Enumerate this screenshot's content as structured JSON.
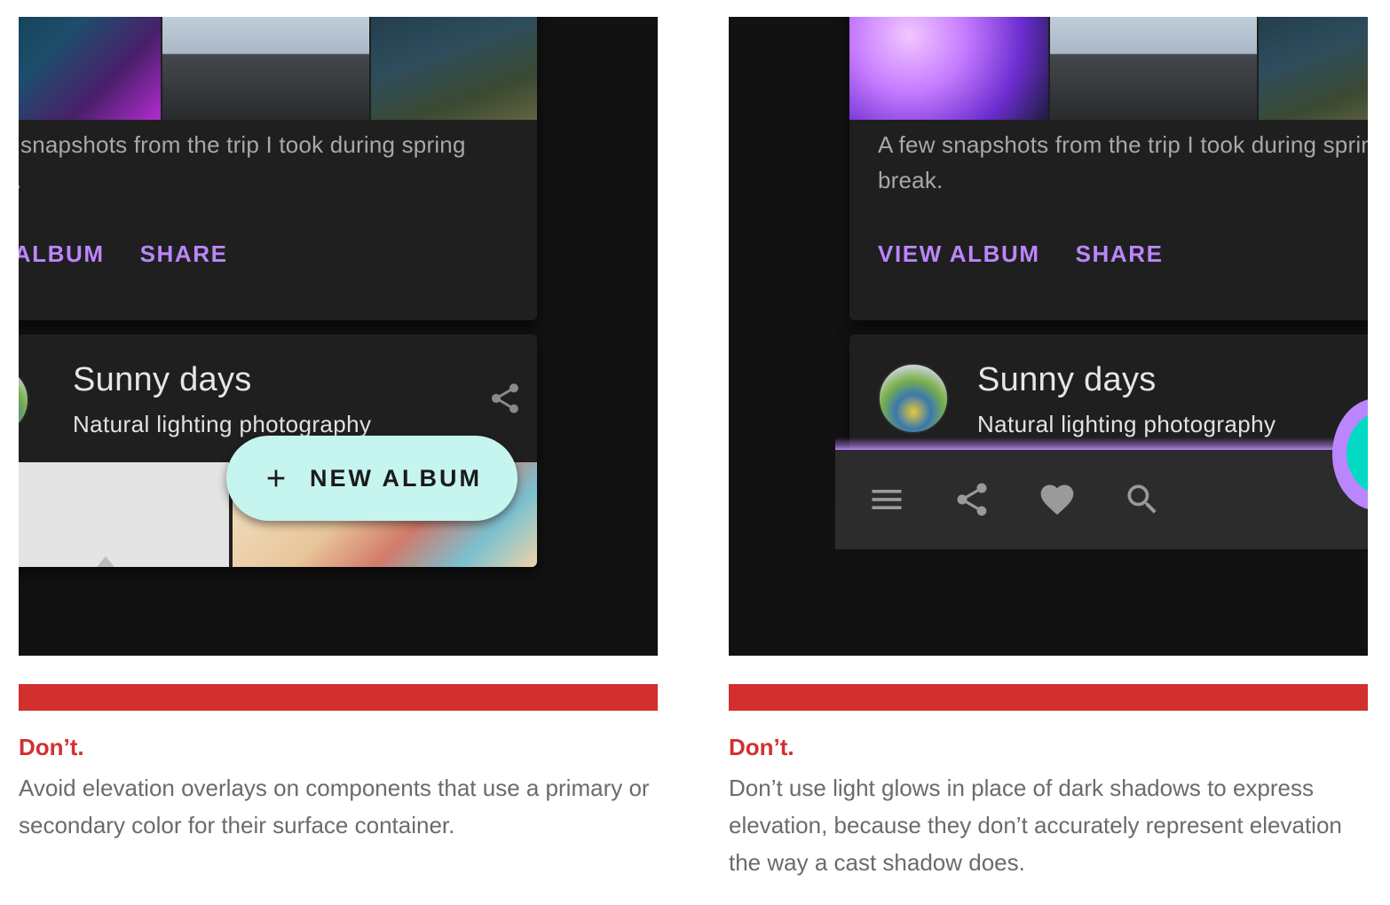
{
  "left": {
    "card": {
      "description": "A few snapshots from the trip I took during spring break.",
      "actions": [
        "VIEW ALBUM",
        "SHARE"
      ]
    },
    "second_card": {
      "title": "Sunny days",
      "subtitle": "Natural lighting photography"
    },
    "fab": {
      "icon": "plus-icon",
      "label": "NEW ALBUM"
    },
    "verdict": "Don’t.",
    "caption": "Avoid elevation overlays on components that use a primary or secondary color for their surface container."
  },
  "right": {
    "card": {
      "description": "A few snapshots from the trip I took during spring break.",
      "actions": [
        "VIEW ALBUM",
        "SHARE"
      ]
    },
    "second_card": {
      "title": "Sunny days",
      "subtitle": "Natural lighting photography"
    },
    "bottom_bar": {
      "icons": [
        "menu-icon",
        "share-icon",
        "heart-icon",
        "search-icon"
      ]
    },
    "verdict": "Don’t.",
    "caption": "Don’t use light glows in place of dark shadows to express elevation, because they don’t accurately represent elevation the way a cast shadow does."
  },
  "colors": {
    "primary": "#bb86fc",
    "secondary": "#c6f4ef",
    "teal_fab": "#03dac5",
    "surface": "#1f1f1f",
    "background": "#121212",
    "error": "#d32f2f"
  }
}
